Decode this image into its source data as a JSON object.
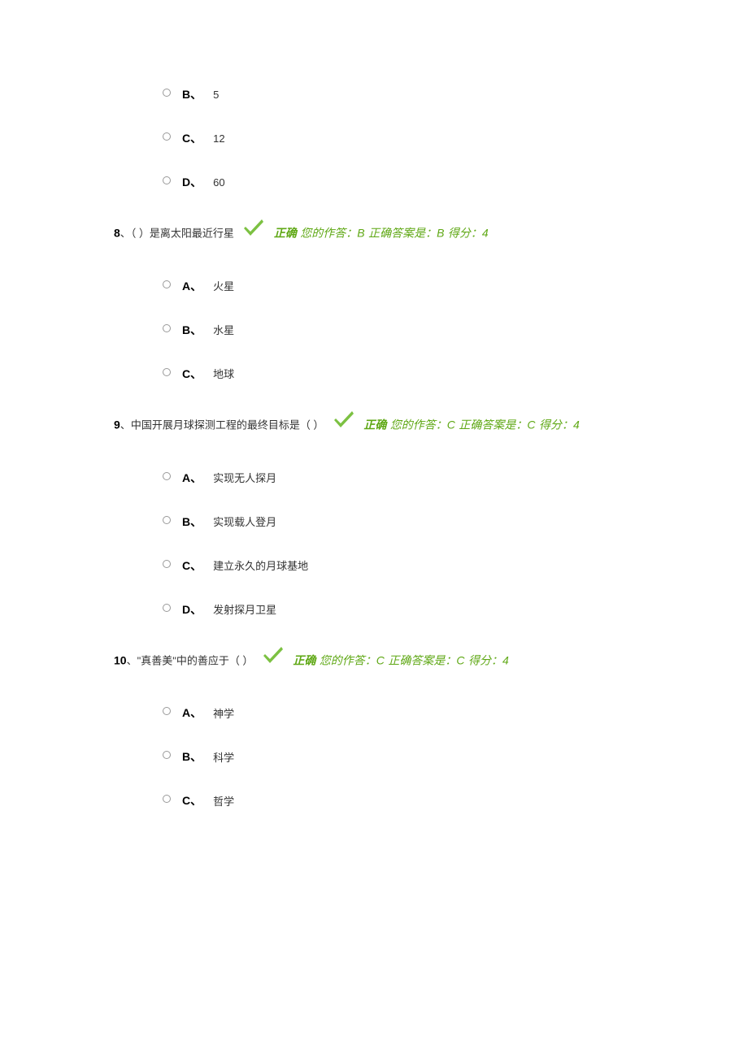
{
  "partial_options_top": [
    {
      "letter": "B、",
      "text": "5"
    },
    {
      "letter": "C、",
      "text": "12"
    },
    {
      "letter": "D、",
      "text": "60"
    }
  ],
  "questions": [
    {
      "number": "8",
      "sep": "、",
      "text": "（ ）是离太阳最近行星",
      "correct_label": "正确",
      "your_answer_label": "您的作答：",
      "your_answer": "B",
      "correct_answer_label": "正确答案是：",
      "correct_answer": "B",
      "score_label": "得分：",
      "score": "4",
      "options": [
        {
          "letter": "A、",
          "text": "火星"
        },
        {
          "letter": "B、",
          "text": "水星"
        },
        {
          "letter": "C、",
          "text": "地球"
        }
      ]
    },
    {
      "number": "9",
      "sep": "、",
      "text": "中国开展月球探测工程的最终目标是（ ）",
      "correct_label": "正确",
      "your_answer_label": "您的作答：",
      "your_answer": "C",
      "correct_answer_label": "正确答案是：",
      "correct_answer": "C",
      "score_label": "得分：",
      "score": "4",
      "options": [
        {
          "letter": "A、",
          "text": "实现无人探月"
        },
        {
          "letter": "B、",
          "text": "实现载人登月"
        },
        {
          "letter": "C、",
          "text": "建立永久的月球基地"
        },
        {
          "letter": "D、",
          "text": "发射探月卫星"
        }
      ]
    },
    {
      "number": "10",
      "sep": "、",
      "text": "\"真善美\"中的善应于（ ）",
      "correct_label": "正确",
      "your_answer_label": "您的作答：",
      "your_answer": "C",
      "correct_answer_label": "正确答案是：",
      "correct_answer": "C",
      "score_label": "得分：",
      "score": "4",
      "options": [
        {
          "letter": "A、",
          "text": "神学"
        },
        {
          "letter": "B、",
          "text": "科学"
        },
        {
          "letter": "C、",
          "text": "哲学"
        }
      ]
    }
  ]
}
